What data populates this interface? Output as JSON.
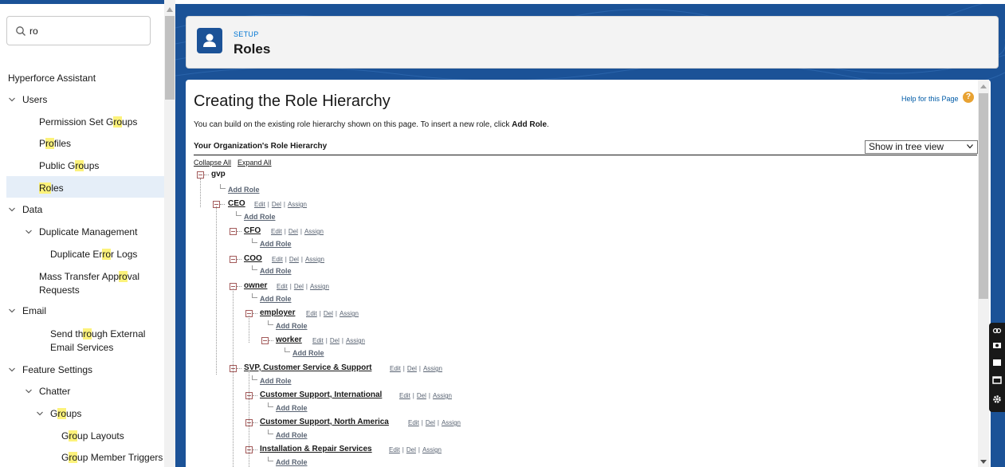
{
  "sidebar": {
    "search": {
      "value": "ro",
      "placeholder": ""
    },
    "items": [
      {
        "id": "hyperforce",
        "parts": [
          "Hyperforce Assistant"
        ]
      },
      {
        "id": "users",
        "parts": [
          "Users"
        ],
        "expanded": true
      },
      {
        "id": "permission-set-groups",
        "parts": [
          "Permission Set G",
          "ro",
          "ups"
        ]
      },
      {
        "id": "profiles",
        "parts": [
          "P",
          "ro",
          "files"
        ]
      },
      {
        "id": "public-groups",
        "parts": [
          "Public G",
          "ro",
          "ups"
        ]
      },
      {
        "id": "roles",
        "parts": [
          "",
          "Ro",
          "les"
        ],
        "selected": true
      },
      {
        "id": "data",
        "parts": [
          "Data"
        ],
        "expanded": true
      },
      {
        "id": "duplicate-management",
        "parts": [
          "Duplicate Management"
        ],
        "expanded": true
      },
      {
        "id": "duplicate-error-logs",
        "parts": [
          "Duplicate Er",
          "ro",
          "r Logs"
        ]
      },
      {
        "id": "mass-transfer",
        "parts": [
          "Mass Transfer App",
          "ro",
          "val Requests"
        ]
      },
      {
        "id": "email",
        "parts": [
          "Email"
        ],
        "expanded": true
      },
      {
        "id": "send-through",
        "parts": [
          "Send th",
          "ro",
          "ugh External Email Services"
        ]
      },
      {
        "id": "feature-settings",
        "parts": [
          "Feature Settings"
        ],
        "expanded": true
      },
      {
        "id": "chatter",
        "parts": [
          "Chatter"
        ],
        "expanded": true
      },
      {
        "id": "groups",
        "parts": [
          "G",
          "ro",
          "ups"
        ],
        "expanded": true
      },
      {
        "id": "group-layouts",
        "parts": [
          "G",
          "ro",
          "up Layouts"
        ]
      },
      {
        "id": "group-member-triggers",
        "parts": [
          "G",
          "ro",
          "up Member Triggers"
        ]
      }
    ]
  },
  "header": {
    "section": "SETUP",
    "title": "Roles"
  },
  "content": {
    "heading": "Creating the Role Hierarchy",
    "help_link": "Help for this Page",
    "intro_text": "You can build on the existing role hierarchy shown on this page. To insert a new role, click ",
    "intro_bold": "Add Role",
    "intro_end": ".",
    "org_label": "Your Organization's Role Hierarchy",
    "view_select": "Show in tree view",
    "collapse_all": "Collapse All",
    "expand_all": "Expand All",
    "add_role_label": "Add Role",
    "actions": {
      "edit": "Edit",
      "del": "Del",
      "assign": "Assign"
    },
    "tree": {
      "root": "gvp",
      "nodes": [
        {
          "id": "ceo",
          "name": "CEO"
        },
        {
          "id": "cfo",
          "name": "CFO"
        },
        {
          "id": "coo",
          "name": "COO"
        },
        {
          "id": "owner",
          "name": "owner"
        },
        {
          "id": "employer",
          "name": "employer"
        },
        {
          "id": "worker",
          "name": "worker"
        },
        {
          "id": "svp",
          "name": "SVP, Customer Service & Support"
        },
        {
          "id": "cs-international",
          "name": "Customer Support, International"
        },
        {
          "id": "cs-north-america",
          "name": "Customer Support, North America"
        },
        {
          "id": "installation",
          "name": "Installation & Repair Services"
        }
      ]
    }
  },
  "colors": {
    "brand": "#1b5297",
    "highlight": "#fcf27b",
    "selected": "#e5eef8",
    "link": "#015ba7"
  }
}
